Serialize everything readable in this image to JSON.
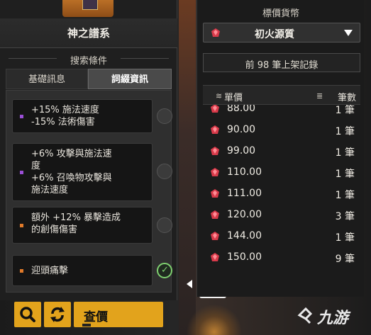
{
  "left": {
    "title": "神之譜系",
    "search_label": "搜索條件",
    "tabs": [
      {
        "label": "基礎訊息",
        "active": false
      },
      {
        "label": "詞綴資訊",
        "active": true
      }
    ],
    "affixes": [
      {
        "text": "+15% 施法速度\n-15% 法術傷害",
        "marker_color": "#9b4fd6",
        "selected": false
      },
      {
        "text": "+6% 攻擊與施法速\n度\n+6% 召喚物攻擊與\n施法速度",
        "marker_color": "#9b4fd6",
        "selected": false
      },
      {
        "text": "額外 +12% 暴擊造成\n的創傷傷害",
        "marker_color": "#e07a2a",
        "selected": false
      },
      {
        "text": "迎頭痛擊",
        "marker_color": "#e07a2a",
        "selected": true
      }
    ],
    "buttons": {
      "query_label": "查價"
    }
  },
  "right": {
    "currency_label": "標價貨幣",
    "currency_selected": "初火源質",
    "records_text": "前 98 筆上架記錄",
    "columns": {
      "price": "單價",
      "count": "筆數"
    },
    "rows": [
      {
        "price": "88.00",
        "count": "1 筆"
      },
      {
        "price": "90.00",
        "count": "1 筆"
      },
      {
        "price": "99.00",
        "count": "1 筆"
      },
      {
        "price": "110.00",
        "count": "1 筆"
      },
      {
        "price": "111.00",
        "count": "1 筆"
      },
      {
        "price": "120.00",
        "count": "3 筆"
      },
      {
        "price": "144.00",
        "count": "1 筆"
      },
      {
        "price": "150.00",
        "count": "9 筆"
      }
    ]
  },
  "watermark": {
    "text": "九游"
  },
  "colors": {
    "accent": "#e2a31c",
    "gem": "#d83a4a",
    "check": "#7fd070"
  }
}
